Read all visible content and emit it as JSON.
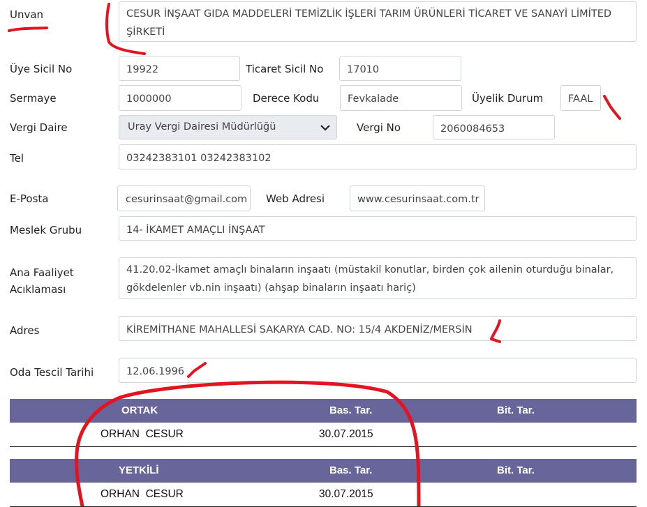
{
  "form": {
    "unvan": {
      "label": "Unvan",
      "value": "CESUR İNŞAAT GIDA MADDELERİ TEMİZLİK İŞLERİ TARIM ÜRÜNLERİ TİCARET VE SANAYİ LİMİTED ŞİRKETİ"
    },
    "uye_sicil": {
      "label": "Üye Sicil No",
      "value": "19922"
    },
    "ticaret_sicil": {
      "label": "Ticaret Sicil No",
      "value": "17010"
    },
    "sermaye": {
      "label": "Sermaye",
      "value": "1000000"
    },
    "derece_kodu": {
      "label": "Derece Kodu",
      "value": "Fevkalade"
    },
    "uyelik_durum": {
      "label": "Üyelik Durum",
      "value": "FAAL"
    },
    "vergi_daire": {
      "label": "Vergi Daire",
      "value": "Uray Vergi Dairesi Müdürlüğü"
    },
    "vergi_no": {
      "label": "Vergi No",
      "value": "2060084653"
    },
    "tel": {
      "label": "Tel",
      "value": "03242383101 03242383102"
    },
    "eposta": {
      "label": "E-Posta",
      "value": "cesurinsaat@gmail.com"
    },
    "web": {
      "label": "Web Adresi",
      "value": "www.cesurinsaat.com.tr"
    },
    "meslek": {
      "label": "Meslek Grubu",
      "value": "14- İKAMET AMAÇLI İNŞAAT"
    },
    "faaliyet": {
      "label_line1": "Ana Faaliyet",
      "label_line2": "Acıklaması",
      "value": "41.20.02-İkamet amaçlı binaların inşaatı (müstakil konutlar, birden çok ailenin oturduğu binalar, gökdelenler vb.nin inşaatı) (ahşap binaların inşaatı hariç)"
    },
    "adres": {
      "label": "Adres",
      "value": "KİREMİTHANE MAHALLESİ SAKARYA CAD. NO: 15/4 AKDENİZ/MERSİN"
    },
    "oda_tescil": {
      "label": "Oda Tescil Tarihi",
      "value": "12.06.1996"
    }
  },
  "tables": {
    "ortak": {
      "headers": [
        "ORTAK",
        "Bas. Tar.",
        "Bit. Tar."
      ],
      "row": [
        "ORHAN  CESUR",
        "30.07.2015",
        ""
      ]
    },
    "yetkili": {
      "headers": [
        "YETKİLİ",
        "Bas. Tar.",
        "Bit. Tar."
      ],
      "row": [
        "ORHAN  CESUR",
        "30.07.2015",
        ""
      ]
    }
  },
  "colors": {
    "header_bg": "#67659a",
    "annotation": "#e3141f"
  },
  "icons": {
    "select_arrow": "chevron-down-icon"
  }
}
